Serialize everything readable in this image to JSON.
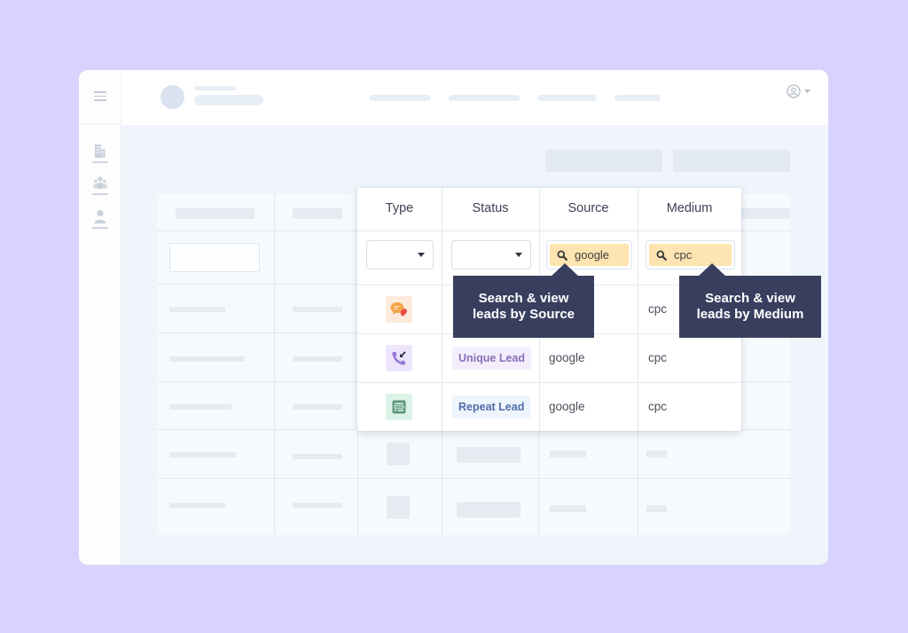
{
  "header": {
    "user_menu_icon": "user-circle-icon",
    "user_menu_caret": "caret-down-icon"
  },
  "sidebar": {
    "menu_icon": "hamburger-icon",
    "items": [
      {
        "icon": "building-icon"
      },
      {
        "icon": "team-icon"
      },
      {
        "icon": "user-icon"
      }
    ]
  },
  "table": {
    "columns": [
      "Type",
      "Status",
      "Source",
      "Medium"
    ],
    "filters": {
      "type_select": "",
      "status_select": "",
      "source_search": "google",
      "medium_search": "cpc"
    },
    "rows": [
      {
        "type_icon": "chat-icon",
        "status": "",
        "source": "",
        "medium": "cpc"
      },
      {
        "type_icon": "incoming-call-icon",
        "status": "Unique Lead",
        "source": "google",
        "medium": "cpc"
      },
      {
        "type_icon": "form-icon",
        "status": "Repeat Lead",
        "source": "google",
        "medium": "cpc"
      }
    ]
  },
  "tooltips": {
    "source": [
      "Search & view",
      "leads by Source"
    ],
    "medium": [
      "Search & view",
      "leads by Medium"
    ]
  },
  "colors": {
    "background": "#d8d2fd",
    "tooltip": "#383f5e",
    "search_highlight": "#fde4b0",
    "unique_lead_bg": "#f3eefc",
    "unique_lead_text": "#8a6fb8",
    "repeat_lead_bg": "#eef4fc",
    "repeat_lead_text": "#4f6da8"
  }
}
